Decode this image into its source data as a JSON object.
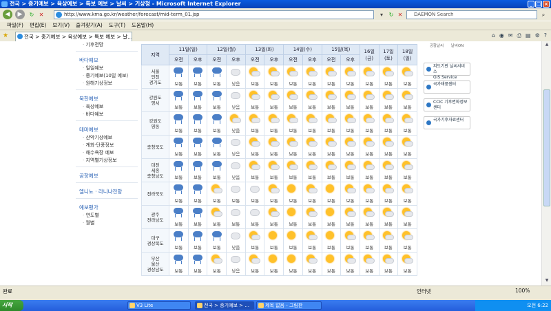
{
  "window": {
    "title": "전국 > 중기예보 > 육상예보 > 특보 예보 > 날씨 > 기상청 - Microsoft Internet Explorer"
  },
  "address": {
    "url": "http://www.kma.go.kr/weather/forecast/mid-term_01.jsp",
    "search_placeholder": "DAEMON Search"
  },
  "menu": [
    "파일(F)",
    "편집(E)",
    "보기(V)",
    "즐겨찾기(A)",
    "도구(T)",
    "도움말(H)"
  ],
  "tab": {
    "label": "전국 > 중기예보 > 육상예보 > 특보 예보 > 날..."
  },
  "leftnav": {
    "items": [
      {
        "type": "sub",
        "label": "기후전망"
      },
      {
        "type": "head",
        "label": "바다예보"
      },
      {
        "type": "sub",
        "label": "일일예보"
      },
      {
        "type": "sub",
        "label": "중기예보(10일 예보)"
      },
      {
        "type": "sub",
        "label": "원해기상정보"
      },
      {
        "type": "head",
        "label": "북한예보"
      },
      {
        "type": "sub",
        "label": "육상예보"
      },
      {
        "type": "sub",
        "label": "바다예보"
      },
      {
        "type": "head",
        "label": "테마예보"
      },
      {
        "type": "sub",
        "label": "산악기상예보"
      },
      {
        "type": "sub",
        "label": "계화·단풍정보"
      },
      {
        "type": "sub",
        "label": "해수욕장 예보"
      },
      {
        "type": "sub",
        "label": "지역별기상정보"
      },
      {
        "type": "head",
        "label": "공항예보"
      },
      {
        "type": "head",
        "label": "엘니뇨 · 라니냐전망"
      },
      {
        "type": "head",
        "label": "예보평가"
      },
      {
        "type": "sub",
        "label": "연도별"
      },
      {
        "type": "sub",
        "label": "월별"
      }
    ]
  },
  "forecast": {
    "region_header": "지역",
    "days": [
      {
        "label": "11일(일)",
        "split": true
      },
      {
        "label": "12일(월)",
        "split": true
      },
      {
        "label": "13일(화)",
        "split": true
      },
      {
        "label": "14일(수)",
        "split": true
      },
      {
        "label": "15일(목)",
        "split": true
      },
      {
        "label": "16일(금)",
        "split": false
      },
      {
        "label": "17일(토)",
        "split": false
      },
      {
        "label": "18일(일)",
        "split": false
      }
    ],
    "am": "오전",
    "pm": "오후",
    "rows": [
      {
        "region": "서울\n인천\n경기도",
        "cells": [
          [
            "rain",
            "보통"
          ],
          [
            "rain",
            "보통"
          ],
          [
            "rain",
            "보통"
          ],
          [
            "cloud",
            "낮음"
          ],
          [
            "partly",
            "보통"
          ],
          [
            "partly",
            "보통"
          ],
          [
            "partly",
            "보통"
          ],
          [
            "partly",
            "보통"
          ],
          [
            "partly",
            "보통"
          ],
          [
            "partly",
            "보통"
          ],
          [
            "partly",
            "보통"
          ],
          [
            "partly",
            "보통"
          ],
          [
            "partly",
            "보통"
          ]
        ]
      },
      {
        "region": "강원도\n영서",
        "cells": [
          [
            "rain",
            "보통"
          ],
          [
            "rain",
            "보통"
          ],
          [
            "rain",
            "보통"
          ],
          [
            "cloud",
            "낮음"
          ],
          [
            "partly",
            "보통"
          ],
          [
            "partly",
            "보통"
          ],
          [
            "partly",
            "보통"
          ],
          [
            "partly",
            "보통"
          ],
          [
            "partly",
            "보통"
          ],
          [
            "partly",
            "보통"
          ],
          [
            "partly",
            "보통"
          ],
          [
            "partly",
            "보통"
          ],
          [
            "partly",
            "보통"
          ]
        ]
      },
      {
        "region": "강원도\n영동",
        "cells": [
          [
            "rain",
            "보통"
          ],
          [
            "rain",
            "보통"
          ],
          [
            "rain",
            "보통"
          ],
          [
            "partly",
            "낮음"
          ],
          [
            "partly",
            "보통"
          ],
          [
            "partly",
            "보통"
          ],
          [
            "partly",
            "보통"
          ],
          [
            "partly",
            "보통"
          ],
          [
            "partly",
            "보통"
          ],
          [
            "partly",
            "보통"
          ],
          [
            "partly",
            "보통"
          ],
          [
            "partly",
            "보통"
          ],
          [
            "partly",
            "보통"
          ]
        ]
      },
      {
        "region": "충청북도",
        "cells": [
          [
            "rain",
            "보통"
          ],
          [
            "rain",
            "보통"
          ],
          [
            "rain",
            "보통"
          ],
          [
            "cloud",
            "낮음"
          ],
          [
            "partly",
            "보통"
          ],
          [
            "partly",
            "보통"
          ],
          [
            "partly",
            "보통"
          ],
          [
            "partly",
            "보통"
          ],
          [
            "partly",
            "보통"
          ],
          [
            "partly",
            "보통"
          ],
          [
            "partly",
            "보통"
          ],
          [
            "partly",
            "보통"
          ],
          [
            "partly",
            "보통"
          ]
        ]
      },
      {
        "region": "대전\n세종\n충청남도",
        "cells": [
          [
            "rain",
            "보통"
          ],
          [
            "rain",
            "보통"
          ],
          [
            "rain",
            "보통"
          ],
          [
            "cloud",
            "낮음"
          ],
          [
            "partly",
            "보통"
          ],
          [
            "partly",
            "보통"
          ],
          [
            "partly",
            "보통"
          ],
          [
            "partly",
            "보통"
          ],
          [
            "partly",
            "보통"
          ],
          [
            "partly",
            "보통"
          ],
          [
            "partly",
            "보통"
          ],
          [
            "partly",
            "보통"
          ],
          [
            "partly",
            "보통"
          ]
        ]
      },
      {
        "region": "전라북도",
        "cells": [
          [
            "rain",
            "보통"
          ],
          [
            "rain",
            "보통"
          ],
          [
            "partly",
            "보통"
          ],
          [
            "cloud",
            "보통"
          ],
          [
            "cloud",
            "보통"
          ],
          [
            "partly",
            "보통"
          ],
          [
            "sun",
            "보통"
          ],
          [
            "partly",
            "보통"
          ],
          [
            "sun",
            "보통"
          ],
          [
            "partly",
            "보통"
          ],
          [
            "partly",
            "보통"
          ],
          [
            "partly",
            "보통"
          ],
          [
            "partly",
            "보통"
          ]
        ]
      },
      {
        "region": "광주\n전라남도",
        "cells": [
          [
            "rain",
            "보통"
          ],
          [
            "rain",
            "보통"
          ],
          [
            "partly",
            "보통"
          ],
          [
            "cloud",
            "보통"
          ],
          [
            "cloud",
            "보통"
          ],
          [
            "partly",
            "보통"
          ],
          [
            "sun",
            "보통"
          ],
          [
            "partly",
            "보통"
          ],
          [
            "sun",
            "보통"
          ],
          [
            "partly",
            "보통"
          ],
          [
            "partly",
            "보통"
          ],
          [
            "partly",
            "보통"
          ],
          [
            "partly",
            "보통"
          ]
        ]
      },
      {
        "region": "대구\n경상북도",
        "cells": [
          [
            "rain",
            "보통"
          ],
          [
            "rain",
            "보통"
          ],
          [
            "rain",
            "보통"
          ],
          [
            "cloud",
            "낮음"
          ],
          [
            "partly",
            "보통"
          ],
          [
            "sun",
            "보통"
          ],
          [
            "sun",
            "보통"
          ],
          [
            "partly",
            "보통"
          ],
          [
            "sun",
            "보통"
          ],
          [
            "partly",
            "보통"
          ],
          [
            "partly",
            "보통"
          ],
          [
            "partly",
            "보통"
          ],
          [
            "partly",
            "보통"
          ]
        ]
      },
      {
        "region": "부산\n울산\n경상남도",
        "cells": [
          [
            "rain",
            "보통"
          ],
          [
            "rain",
            "보통"
          ],
          [
            "partly",
            "보통"
          ],
          [
            "cloud",
            "낮음"
          ],
          [
            "partly",
            "보통"
          ],
          [
            "sun",
            "보통"
          ],
          [
            "sun",
            "보통"
          ],
          [
            "partly",
            "보통"
          ],
          [
            "sun",
            "보통"
          ],
          [
            "partly",
            "보통"
          ],
          [
            "partly",
            "보통"
          ],
          [
            "partly",
            "보통"
          ],
          [
            "partly",
            "보통"
          ]
        ]
      }
    ]
  },
  "right_panel": {
    "icons": [
      "공항날씨",
      "날씨ON"
    ],
    "banners": [
      "지도기반 날씨서비스\nGIS Service",
      "국가태풍센터",
      "CCIC 기후변화정보센터",
      "국가기후자료센터"
    ]
  },
  "status": {
    "left": "완료",
    "zone": "인터넷",
    "zoom": "100%"
  },
  "taskbar": {
    "start": "시작",
    "tasks": [
      "V3 Lite",
      "전국 > 중기예보 > ...",
      "제목 없음 - 그림판"
    ],
    "clock": "오전 6:22"
  }
}
